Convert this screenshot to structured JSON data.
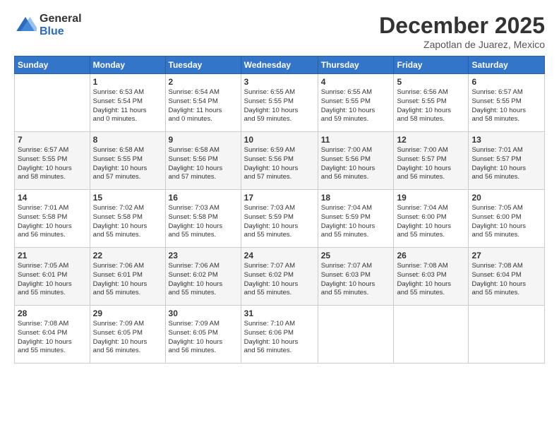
{
  "logo": {
    "general": "General",
    "blue": "Blue"
  },
  "header": {
    "month": "December 2025",
    "location": "Zapotlan de Juarez, Mexico"
  },
  "weekdays": [
    "Sunday",
    "Monday",
    "Tuesday",
    "Wednesday",
    "Thursday",
    "Friday",
    "Saturday"
  ],
  "weeks": [
    [
      {
        "day": "",
        "info": ""
      },
      {
        "day": "1",
        "info": "Sunrise: 6:53 AM\nSunset: 5:54 PM\nDaylight: 11 hours\nand 0 minutes."
      },
      {
        "day": "2",
        "info": "Sunrise: 6:54 AM\nSunset: 5:54 PM\nDaylight: 11 hours\nand 0 minutes."
      },
      {
        "day": "3",
        "info": "Sunrise: 6:55 AM\nSunset: 5:55 PM\nDaylight: 10 hours\nand 59 minutes."
      },
      {
        "day": "4",
        "info": "Sunrise: 6:55 AM\nSunset: 5:55 PM\nDaylight: 10 hours\nand 59 minutes."
      },
      {
        "day": "5",
        "info": "Sunrise: 6:56 AM\nSunset: 5:55 PM\nDaylight: 10 hours\nand 58 minutes."
      },
      {
        "day": "6",
        "info": "Sunrise: 6:57 AM\nSunset: 5:55 PM\nDaylight: 10 hours\nand 58 minutes."
      }
    ],
    [
      {
        "day": "7",
        "info": "Sunrise: 6:57 AM\nSunset: 5:55 PM\nDaylight: 10 hours\nand 58 minutes."
      },
      {
        "day": "8",
        "info": "Sunrise: 6:58 AM\nSunset: 5:55 PM\nDaylight: 10 hours\nand 57 minutes."
      },
      {
        "day": "9",
        "info": "Sunrise: 6:58 AM\nSunset: 5:56 PM\nDaylight: 10 hours\nand 57 minutes."
      },
      {
        "day": "10",
        "info": "Sunrise: 6:59 AM\nSunset: 5:56 PM\nDaylight: 10 hours\nand 57 minutes."
      },
      {
        "day": "11",
        "info": "Sunrise: 7:00 AM\nSunset: 5:56 PM\nDaylight: 10 hours\nand 56 minutes."
      },
      {
        "day": "12",
        "info": "Sunrise: 7:00 AM\nSunset: 5:57 PM\nDaylight: 10 hours\nand 56 minutes."
      },
      {
        "day": "13",
        "info": "Sunrise: 7:01 AM\nSunset: 5:57 PM\nDaylight: 10 hours\nand 56 minutes."
      }
    ],
    [
      {
        "day": "14",
        "info": "Sunrise: 7:01 AM\nSunset: 5:58 PM\nDaylight: 10 hours\nand 56 minutes."
      },
      {
        "day": "15",
        "info": "Sunrise: 7:02 AM\nSunset: 5:58 PM\nDaylight: 10 hours\nand 55 minutes."
      },
      {
        "day": "16",
        "info": "Sunrise: 7:03 AM\nSunset: 5:58 PM\nDaylight: 10 hours\nand 55 minutes."
      },
      {
        "day": "17",
        "info": "Sunrise: 7:03 AM\nSunset: 5:59 PM\nDaylight: 10 hours\nand 55 minutes."
      },
      {
        "day": "18",
        "info": "Sunrise: 7:04 AM\nSunset: 5:59 PM\nDaylight: 10 hours\nand 55 minutes."
      },
      {
        "day": "19",
        "info": "Sunrise: 7:04 AM\nSunset: 6:00 PM\nDaylight: 10 hours\nand 55 minutes."
      },
      {
        "day": "20",
        "info": "Sunrise: 7:05 AM\nSunset: 6:00 PM\nDaylight: 10 hours\nand 55 minutes."
      }
    ],
    [
      {
        "day": "21",
        "info": "Sunrise: 7:05 AM\nSunset: 6:01 PM\nDaylight: 10 hours\nand 55 minutes."
      },
      {
        "day": "22",
        "info": "Sunrise: 7:06 AM\nSunset: 6:01 PM\nDaylight: 10 hours\nand 55 minutes."
      },
      {
        "day": "23",
        "info": "Sunrise: 7:06 AM\nSunset: 6:02 PM\nDaylight: 10 hours\nand 55 minutes."
      },
      {
        "day": "24",
        "info": "Sunrise: 7:07 AM\nSunset: 6:02 PM\nDaylight: 10 hours\nand 55 minutes."
      },
      {
        "day": "25",
        "info": "Sunrise: 7:07 AM\nSunset: 6:03 PM\nDaylight: 10 hours\nand 55 minutes."
      },
      {
        "day": "26",
        "info": "Sunrise: 7:08 AM\nSunset: 6:03 PM\nDaylight: 10 hours\nand 55 minutes."
      },
      {
        "day": "27",
        "info": "Sunrise: 7:08 AM\nSunset: 6:04 PM\nDaylight: 10 hours\nand 55 minutes."
      }
    ],
    [
      {
        "day": "28",
        "info": "Sunrise: 7:08 AM\nSunset: 6:04 PM\nDaylight: 10 hours\nand 55 minutes."
      },
      {
        "day": "29",
        "info": "Sunrise: 7:09 AM\nSunset: 6:05 PM\nDaylight: 10 hours\nand 56 minutes."
      },
      {
        "day": "30",
        "info": "Sunrise: 7:09 AM\nSunset: 6:05 PM\nDaylight: 10 hours\nand 56 minutes."
      },
      {
        "day": "31",
        "info": "Sunrise: 7:10 AM\nSunset: 6:06 PM\nDaylight: 10 hours\nand 56 minutes."
      },
      {
        "day": "",
        "info": ""
      },
      {
        "day": "",
        "info": ""
      },
      {
        "day": "",
        "info": ""
      }
    ]
  ]
}
